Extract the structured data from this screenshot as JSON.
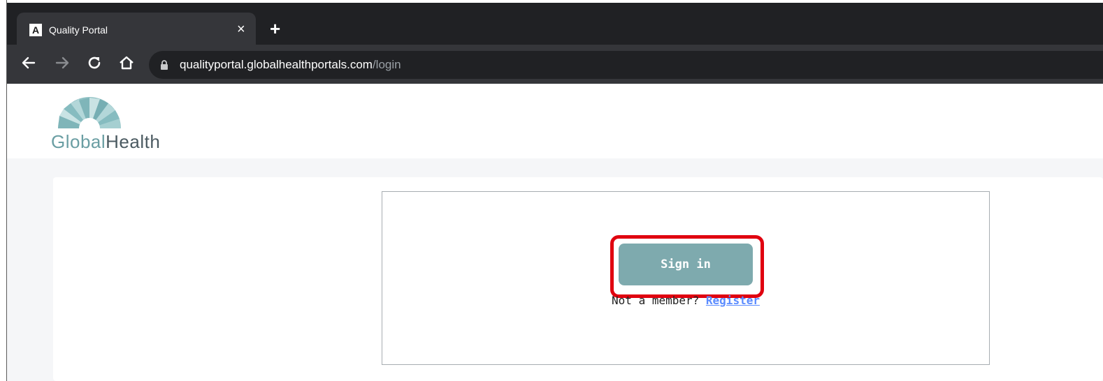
{
  "browser": {
    "tab": {
      "title": "Quality Portal",
      "favicon": "A",
      "close_glyph": "×"
    },
    "new_tab_glyph": "+",
    "url": {
      "host": "qualityportal.globalhealthportals.com",
      "path": "/login"
    }
  },
  "header": {
    "logo": {
      "part1": "Global",
      "part2": "Health"
    }
  },
  "login": {
    "signin_label": "Sign in",
    "not_member_text": "Not a member?",
    "register_label": "Register"
  },
  "colors": {
    "button": "#7eaaae",
    "highlight_border": "#e0000f",
    "link": "#5b8cff",
    "logo_teal": "#6a9ea3",
    "logo_dark": "#4b5a61"
  },
  "icons": [
    "back-arrow-icon",
    "forward-arrow-icon",
    "reload-icon",
    "home-icon",
    "lock-icon",
    "close-icon",
    "plus-icon",
    "angular-favicon-icon"
  ]
}
